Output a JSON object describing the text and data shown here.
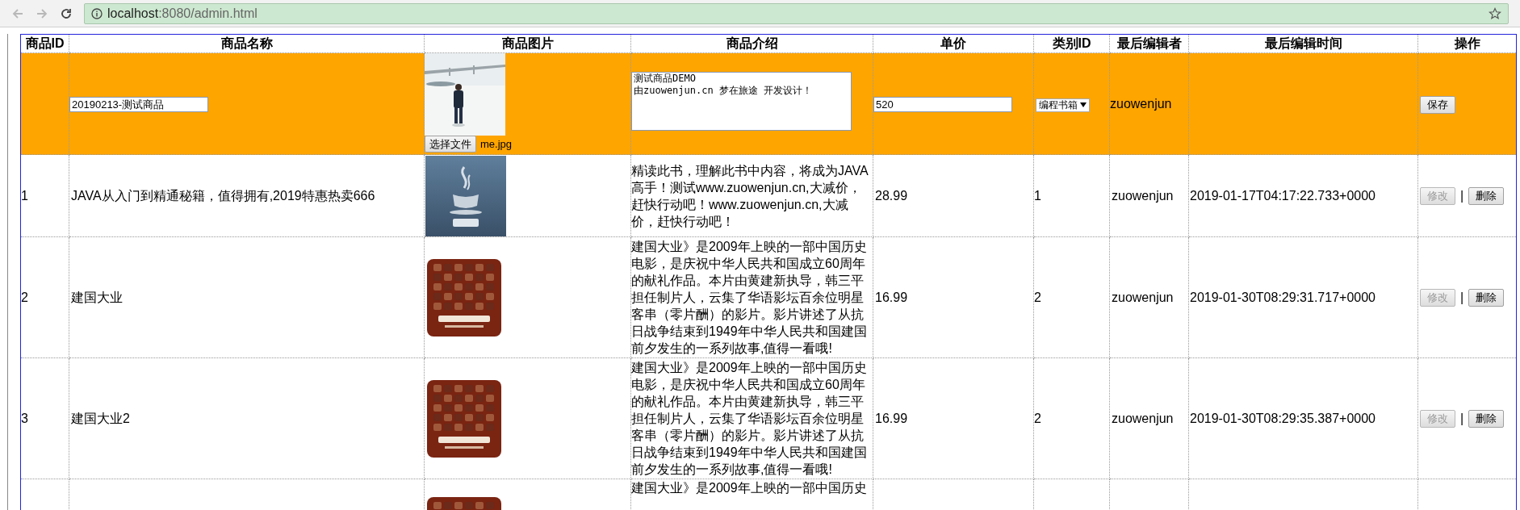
{
  "browser": {
    "url_host": "localhost",
    "url_rest": ":8080/admin.html"
  },
  "table": {
    "columns": [
      "商品ID",
      "商品名称",
      "商品图片",
      "商品介绍",
      "单价",
      "类别ID",
      "最后编辑者",
      "最后编辑时间",
      "操作"
    ],
    "edit_row": {
      "name": "20190213-测试商品",
      "file_button": "选择文件",
      "file_name": "me.jpg",
      "description": "测试商品DEMO\n由zuowenjun.cn 梦在旅途 开发设计！",
      "price": "520",
      "category": "编程书箱",
      "editor": "zuowenjun",
      "save_button": "保存"
    },
    "rows": [
      {
        "id": "1",
        "name": "JAVA从入门到精通秘籍，值得拥有,2019特惠热卖666",
        "description": "精读此书，理解此书中内容，将成为JAVA高手！测试www.zuowenjun.cn,大减价，赶快行动吧！www.zuowenjun.cn,大减价，赶快行动吧！",
        "price": "28.99",
        "category_id": "1",
        "editor": "zuowenjun",
        "edited_at": "2019-01-17T04:17:22.733+0000",
        "edit_button": "修改",
        "edit_disabled": true,
        "separator": "|",
        "delete_button": "删除"
      },
      {
        "id": "2",
        "name": "建国大业",
        "description": "建国大业》是2009年上映的一部中国历史电影，是庆祝中华人民共和国成立60周年的献礼作品。本片由黄建新执导，韩三平担任制片人，云集了华语影坛百余位明星客串（零片酬）的影片。影片讲述了从抗日战争结束到1949年中华人民共和国建国前夕发生的一系列故事,值得一看哦!",
        "price": "16.99",
        "category_id": "2",
        "editor": "zuowenjun",
        "edited_at": "2019-01-30T08:29:31.717+0000",
        "edit_button": "修改",
        "edit_disabled": true,
        "separator": "|",
        "delete_button": "删除"
      },
      {
        "id": "3",
        "name": "建国大业2",
        "description": "建国大业》是2009年上映的一部中国历史电影，是庆祝中华人民共和国成立60周年的献礼作品。本片由黄建新执导，韩三平担任制片人，云集了华语影坛百余位明星客串（零片酬）的影片。影片讲述了从抗日战争结束到1949年中华人民共和国建国前夕发生的一系列故事,值得一看哦!",
        "price": "16.99",
        "category_id": "2",
        "editor": "zuowenjun",
        "edited_at": "2019-01-30T08:29:35.387+0000",
        "edit_button": "修改",
        "edit_disabled": true,
        "separator": "|",
        "delete_button": "删除"
      }
    ],
    "partial_row": {
      "description": "建国大业》是2009年上映的一部中国历史"
    }
  }
}
